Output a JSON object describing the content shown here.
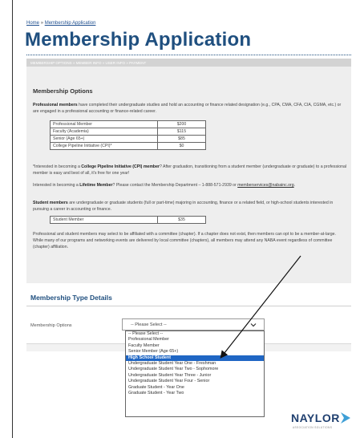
{
  "breadcrumb": {
    "home": "Home",
    "separator": "»",
    "current": "Membership Application"
  },
  "page": {
    "title": "Membership Application"
  },
  "steps": {
    "active": "MEMBERSHIP OPTIONS",
    "sep": "»",
    "s2": "MEMBER INFO",
    "s3": "USER INFO",
    "s4": "PAYMENT"
  },
  "options": {
    "heading": "Membership Options",
    "pro_bold": "Professional members",
    "pro_text": " have completed their undergraduate studies and hold an accounting or finance related designation (e.g., CPA, CMA, CFA, CIA, CGMA, etc.) or are engaged in a professional accounting or finance-related career.",
    "pro_table": [
      {
        "name": "Professional Member",
        "price": "$200"
      },
      {
        "name": "Faculty (Academia)",
        "price": "$115"
      },
      {
        "name": "Senior (Age 65+)",
        "price": "$85"
      },
      {
        "name": "College Pipeline Initiative (CPI)*",
        "price": "$0"
      }
    ],
    "cpi_pre": "*Interested in becoming a ",
    "cpi_bold": "College Pipeline Initiative (CPI) member",
    "cpi_post": "? After graduation, transitioning from a student member (undergraduate or graduate) to a professional member is easy and best of all, it's free for one year!",
    "life_pre": "Interested in becoming a ",
    "life_bold": "Lifetime Member",
    "life_post": "? Please contact the Membership Department – 1-888-571-2939 or ",
    "life_email": "memberservices@nabainc.org",
    "life_end": ".",
    "stu_bold": "Student members",
    "stu_text": " are undergraduate or graduate students (full or part-time) majoring in accounting, finance or a related field, or high-school students interested in pursuing a career in accounting or finance.",
    "stu_table": [
      {
        "name": "Student Member",
        "price": "$35"
      }
    ],
    "chapter_text": "Professional and student members may select to be affiliated with a committee (chapter). If a chapter does not exist, then members can opt to be a member-at-large. While many of our programs and networking events are delivered by local committee (chapters), all members may attend any NABA event regardless of committee (chapter) affiliation."
  },
  "type_details": {
    "heading": "Membership Type Details",
    "field_label": "Membership Options",
    "select_value": "-- Please Select --",
    "chevron_icon": "chevron-down-icon",
    "dropdown_options": [
      "-- Please Select --",
      "Professional Member",
      "Faculty Member",
      "Senior Member (Age 65+)",
      "High School Student",
      "Undergraduate Student Year One - Freshman",
      "Undergraduate Student Year Two - Sophomore",
      "Undergraduate Student Year Three - Junior",
      "Undergraduate Student Year Four - Senior",
      "Graduate Student - Year One",
      "Graduate Student - Year Two"
    ],
    "selected_index": 4
  },
  "footer": {
    "logo": "NAYLOR",
    "tagline": "ASSOCIATION SOLUTIONS"
  },
  "colors": {
    "title": "#1f4f7f",
    "selection": "#1f66c4",
    "panel": "#eeeeee"
  }
}
